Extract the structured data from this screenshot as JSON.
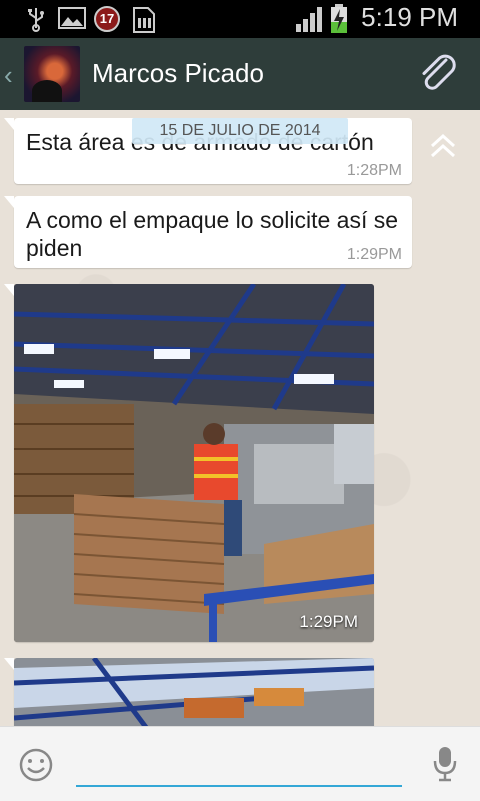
{
  "status_bar": {
    "notification_count": "17",
    "time": "5:19 PM",
    "icons": [
      "usb-icon",
      "image-icon",
      "notification-badge",
      "sd-card-icon",
      "signal-icon",
      "battery-charging-icon"
    ]
  },
  "header": {
    "contact_name": "Marcos Picado",
    "icons": [
      "back-chevron-icon",
      "avatar",
      "paperclip-icon"
    ]
  },
  "chat": {
    "date_chip": "15 DE JULIO DE 2014",
    "messages": [
      {
        "type": "text",
        "text": "Esta área es de armado de cartón",
        "time": "1:28PM"
      },
      {
        "type": "text",
        "text": "A como el empaque lo solicite así se piden",
        "time": "1:29PM"
      },
      {
        "type": "image",
        "description_icon": "warehouse-photo",
        "time": "1:29PM"
      },
      {
        "type": "image",
        "description_icon": "warehouse-photo",
        "time": ""
      }
    ]
  },
  "input_bar": {
    "icons": [
      "emoji-icon",
      "mic-icon"
    ],
    "placeholder": ""
  },
  "colors": {
    "header_bg": "#2e3d3a",
    "accent": "#33a7d6",
    "chat_bg": "#e8e1d8",
    "bubble_bg": "#ffffff"
  }
}
